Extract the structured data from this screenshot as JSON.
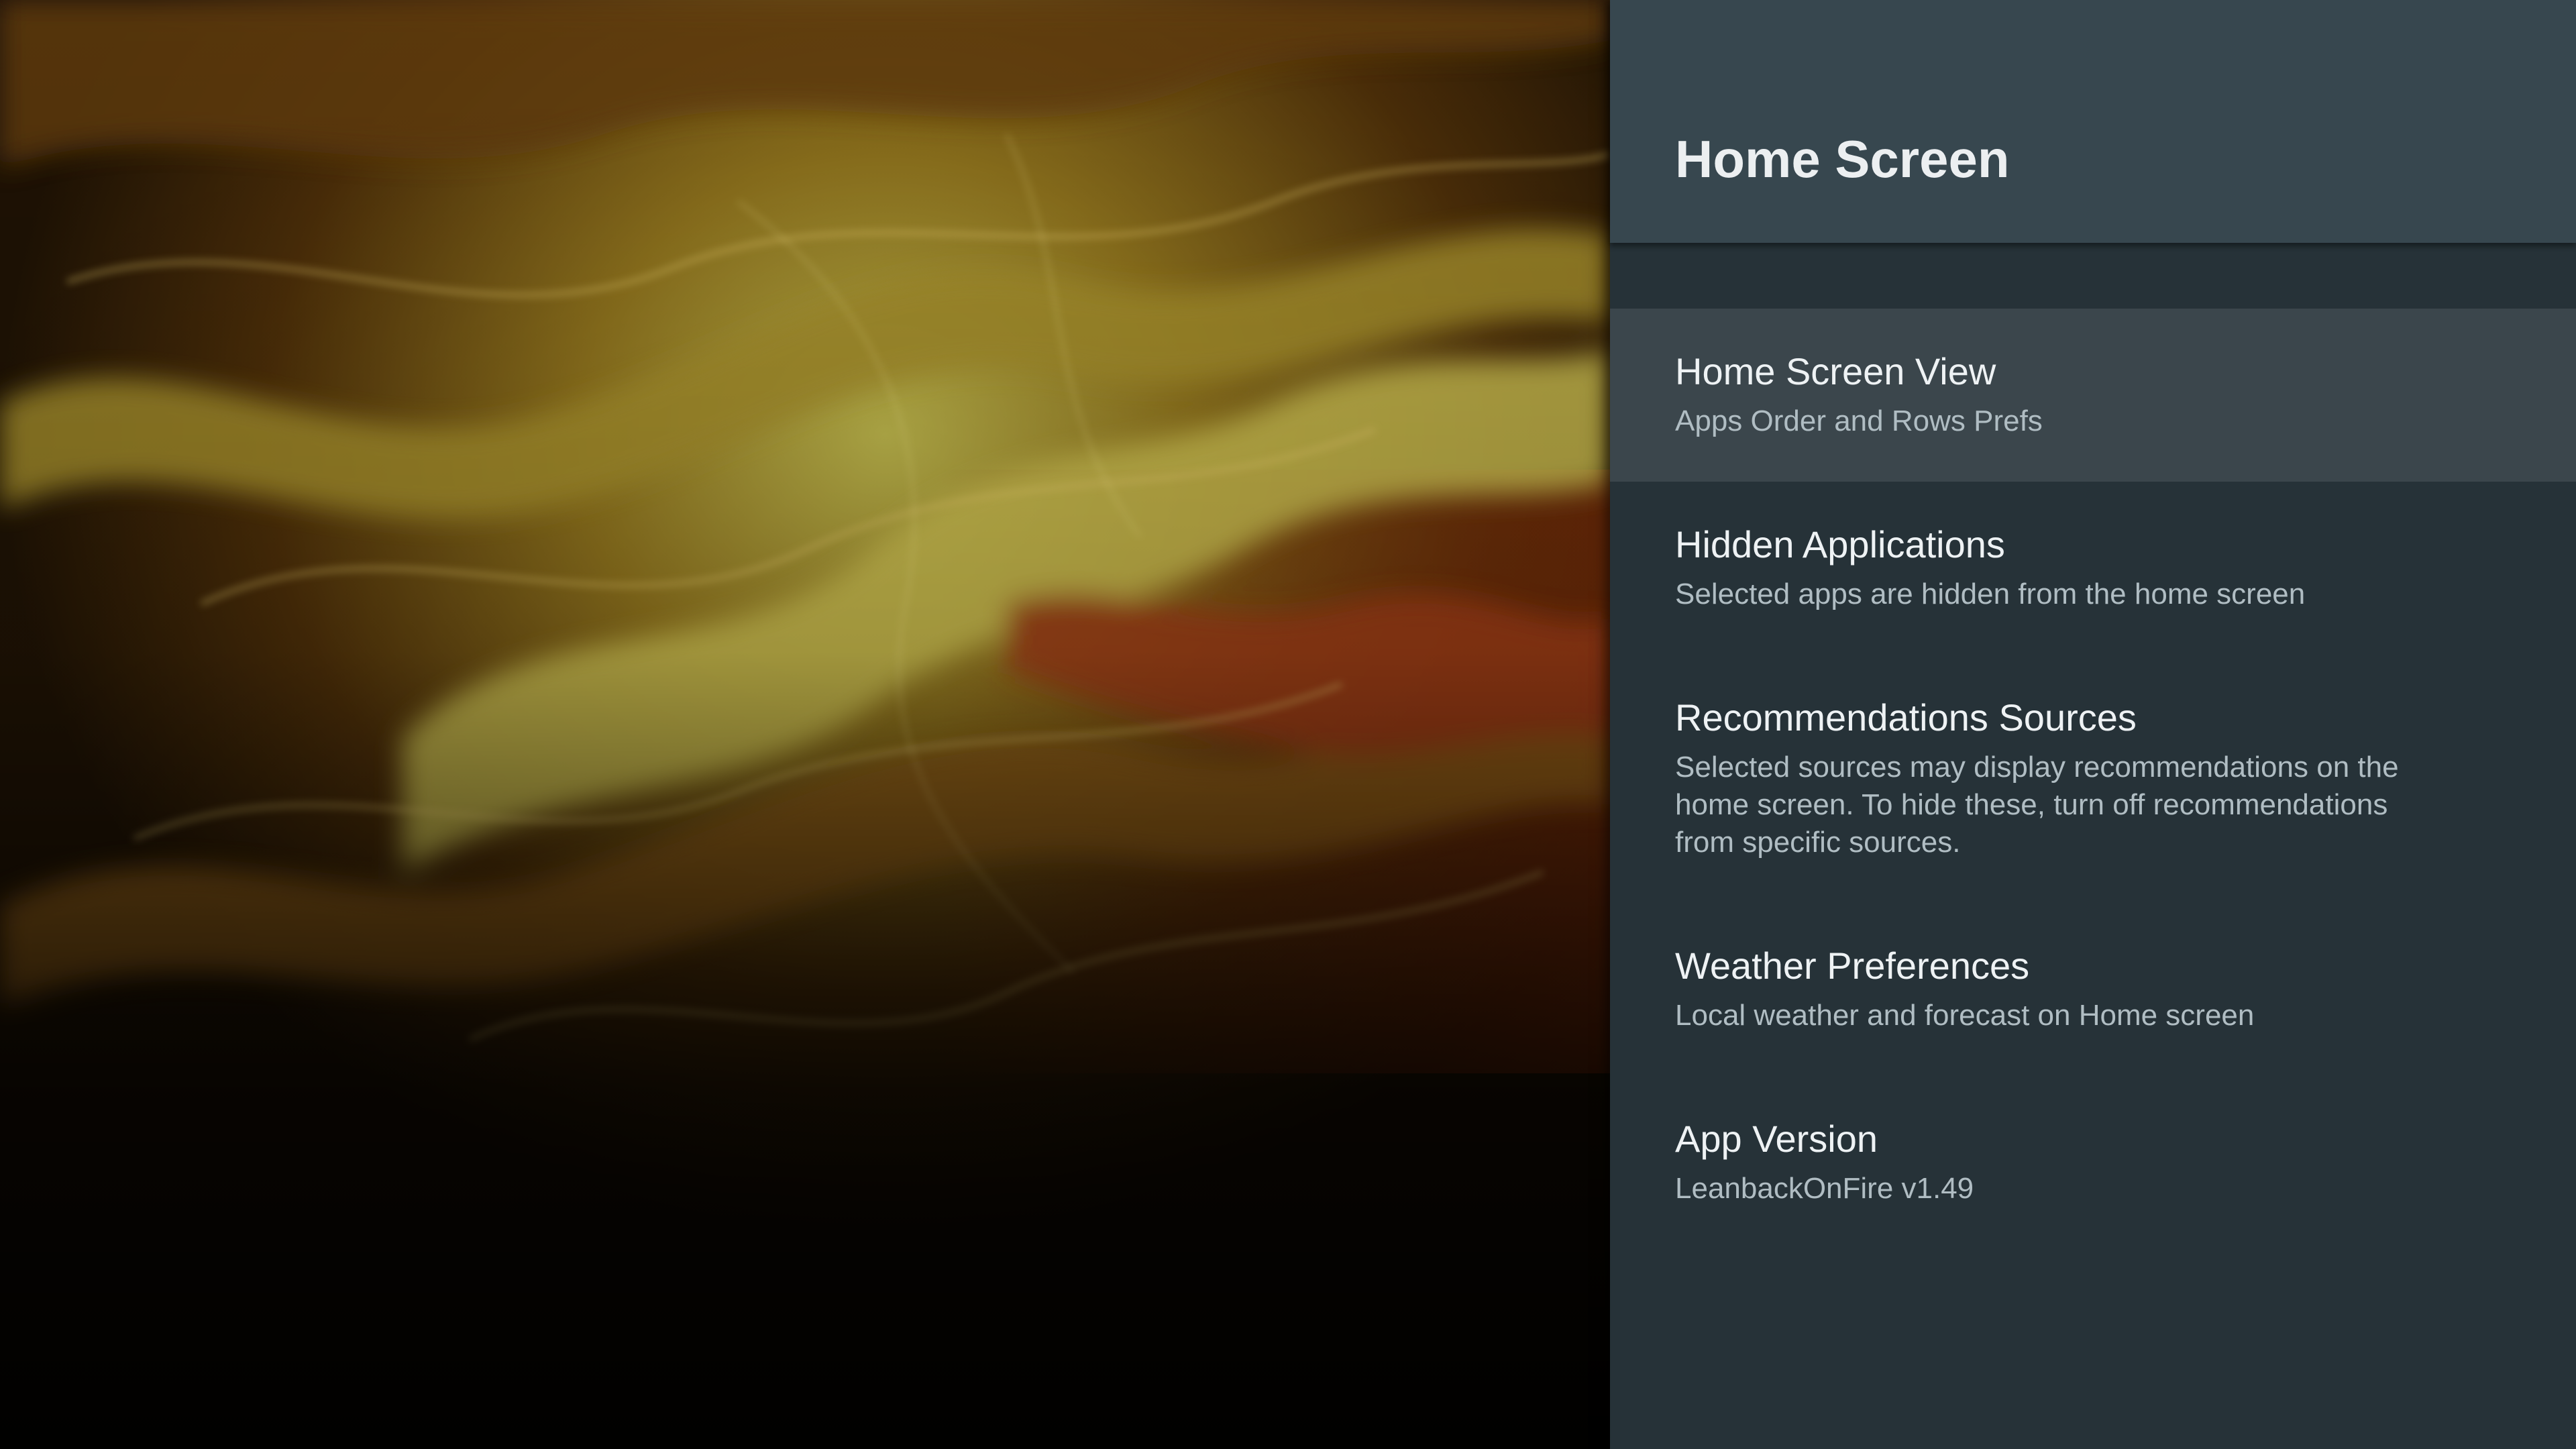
{
  "panel": {
    "title": "Home Screen"
  },
  "menu": {
    "items": [
      {
        "title": "Home Screen View",
        "description": "Apps Order and Rows Prefs",
        "selected": true
      },
      {
        "title": "Hidden Applications",
        "description": "Selected apps are hidden from the home screen",
        "selected": false
      },
      {
        "title": "Recommendations Sources",
        "description": "Selected sources may display recommendations on the home screen. To hide these, turn off recommendations from specific sources.",
        "selected": false
      },
      {
        "title": "Weather Preferences",
        "description": "Local weather and forecast on Home screen",
        "selected": false
      },
      {
        "title": "App Version",
        "description": "LeanbackOnFire v1.49",
        "selected": false
      }
    ]
  },
  "colors": {
    "panel_background": "#263238",
    "header_background": "#37474f",
    "selected_item_background": "#3b464c",
    "title_text": "#eceff1",
    "description_text": "#b0bdc3"
  }
}
